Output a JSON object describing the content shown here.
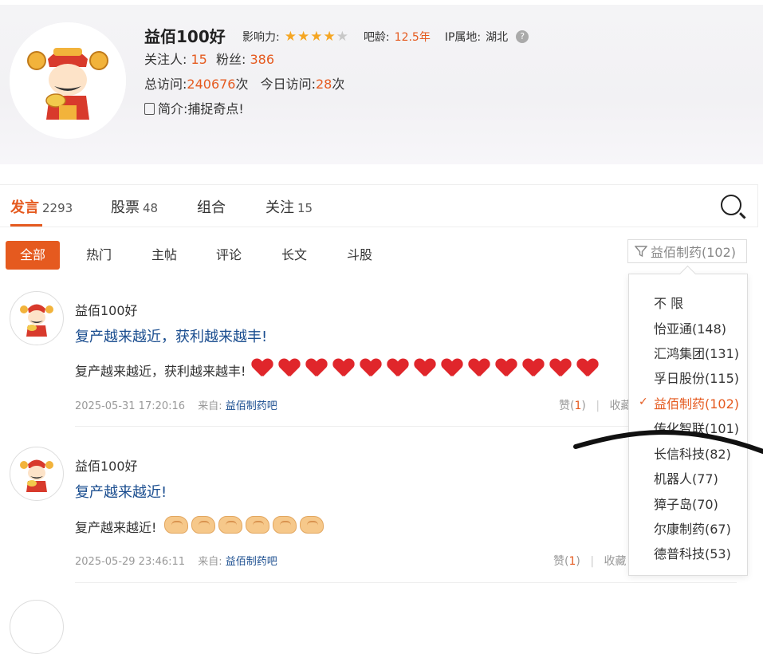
{
  "profile": {
    "username": "益佰100好",
    "influence_label": "影响力:",
    "influence_stars": 4,
    "influence_max": 5,
    "age_label": "吧龄:",
    "age_value": "12.5年",
    "ip_label": "IP属地:",
    "ip_value": "湖北",
    "following_label": "关注人:",
    "following_value": "15",
    "fans_label": "粉丝:",
    "fans_value": "386",
    "visits_label": "总访问:",
    "visits_value": "240676",
    "visits_unit": "次",
    "today_label": "今日访问:",
    "today_value": "28",
    "today_unit": "次",
    "intro_label": "简介:",
    "intro_value": "捕捉奇点!"
  },
  "tabs": [
    {
      "label": "发言",
      "count": "2293"
    },
    {
      "label": "股票",
      "count": "48"
    },
    {
      "label": "组合",
      "count": ""
    },
    {
      "label": "关注",
      "count": "15"
    }
  ],
  "filters": [
    "全部",
    "热门",
    "主帖",
    "评论",
    "长文",
    "斗股"
  ],
  "stock_filter": "益佰制药(102)",
  "dropdown": {
    "items": [
      "不 限",
      "怡亚通(148)",
      "汇鸿集团(131)",
      "孚日股份(115)",
      "益佰制药(102)",
      "传化智联(101)",
      "长信科技(82)",
      "机器人(77)",
      "獐子岛(70)",
      "尔康制药(67)",
      "德普科技(53)"
    ],
    "selected_index": 4
  },
  "posts": [
    {
      "author": "益佰100好",
      "title": "复产越来越近，获利越来越丰!",
      "body": "复产越来越近，获利越来越丰!",
      "emoji": "heart",
      "emoji_count": 13,
      "time": "2025-05-31 17:20:16",
      "from_label": "来自:",
      "from": "益佰制药吧",
      "like_label": "赞",
      "like_count": "1",
      "collect_label": "收藏"
    },
    {
      "author": "益佰100好",
      "title": "复产越来越近!",
      "body": "复产越来越近!",
      "emoji": "handshake",
      "emoji_count": 6,
      "time": "2025-05-29 23:46:11",
      "from_label": "来自:",
      "from": "益佰制药吧",
      "like_label": "赞",
      "like_count": "1",
      "collect_label": "收藏"
    }
  ],
  "colors": {
    "accent": "#e55a1f",
    "link": "#1a4d8f",
    "star": "#f5a623"
  }
}
